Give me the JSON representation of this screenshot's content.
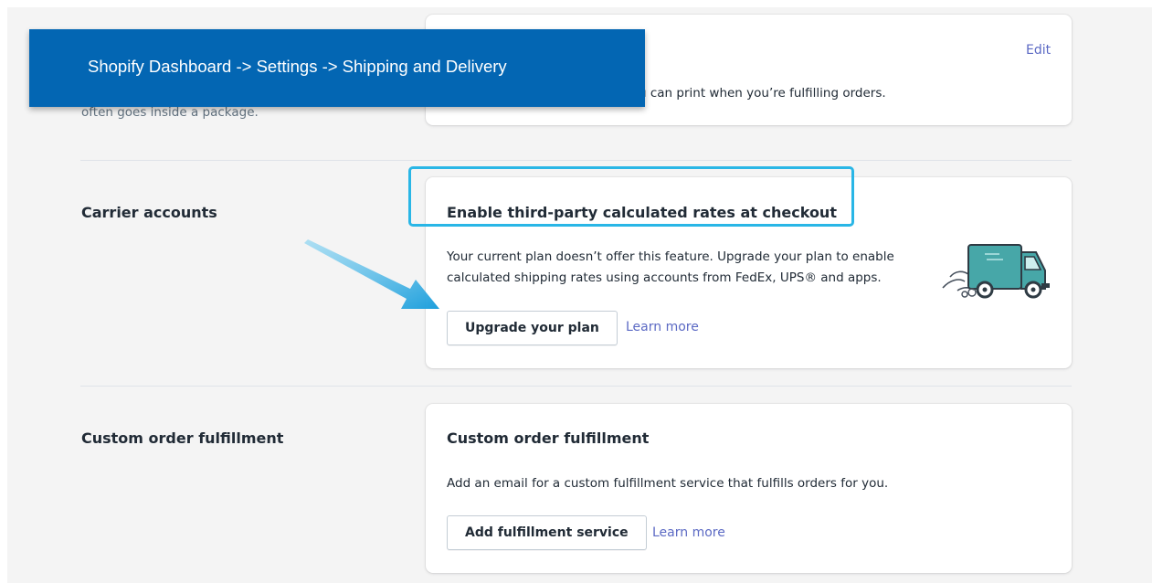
{
  "top_section": {
    "description_fragment": "often goes inside a package.",
    "card_text_fragment": "u can print when you’re fulfilling orders.",
    "edit_link": "Edit"
  },
  "banner": {
    "text": "Shopify Dashboard -> Settings -> Shipping and Delivery",
    "background": "#0366b3"
  },
  "carrier_accounts": {
    "section_title": "Carrier accounts",
    "card_title": "Enable third-party calculated rates at checkout",
    "description_line1": "Your current plan doesn’t offer this feature. Upgrade your plan to enable",
    "description_line2": "calculated shipping rates using accounts from FedEx, UPS® and apps.",
    "button": "Upgrade your plan",
    "learn_more": "Learn more",
    "illustration": "delivery-truck-icon"
  },
  "custom_fulfillment": {
    "section_title": "Custom order fulfillment",
    "card_title": "Custom order fulfillment",
    "description": "Add an email for a custom fulfillment service that fulfills orders for you.",
    "button": "Add fulfillment service",
    "learn_more": "Learn more"
  },
  "annotation": {
    "highlight_color": "#29b6e6",
    "arrow_color": "#29a8e0"
  },
  "colors": {
    "link": "#5c6ac4",
    "text": "#212b36",
    "page_bg": "#f4f4f4"
  }
}
